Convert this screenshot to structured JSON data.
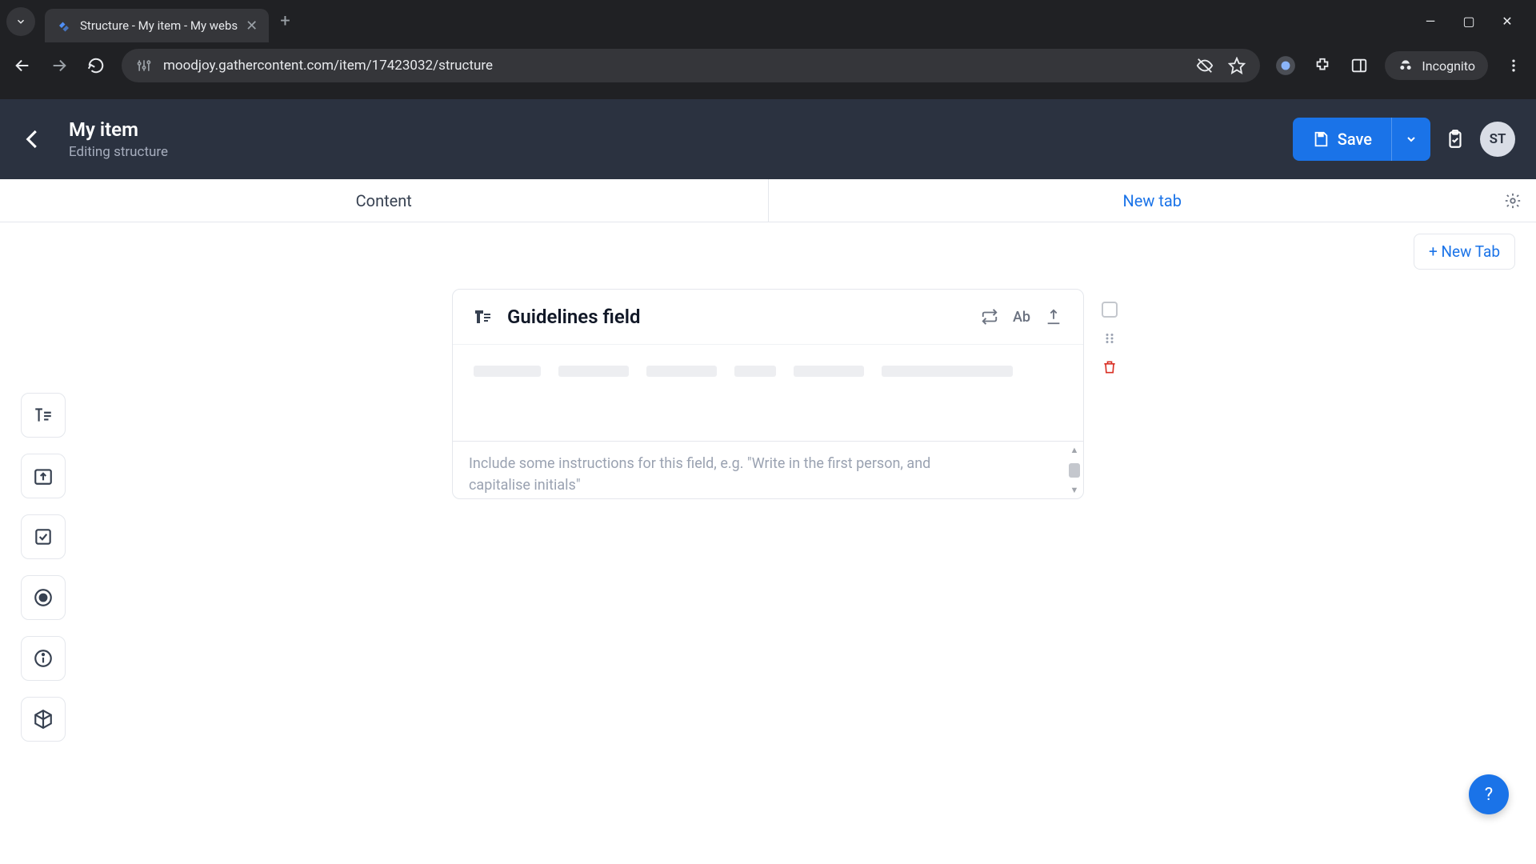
{
  "browser": {
    "tab_title": "Structure - My item - My webs",
    "url": "moodjoy.gathercontent.com/item/17423032/structure",
    "incognito_label": "Incognito"
  },
  "header": {
    "title": "My item",
    "subtitle": "Editing structure",
    "save_label": "Save",
    "avatar_initials": "ST"
  },
  "tabs": {
    "content_label": "Content",
    "new_tab_label": "New tab",
    "add_tab_label": "+ New Tab"
  },
  "field": {
    "title": "Guidelines field",
    "ab_label": "Ab",
    "instructions_placeholder": "Include some instructions for this field, e.g. \"Write in the first person, and capitalise initials\""
  },
  "help": {
    "label": "?"
  }
}
